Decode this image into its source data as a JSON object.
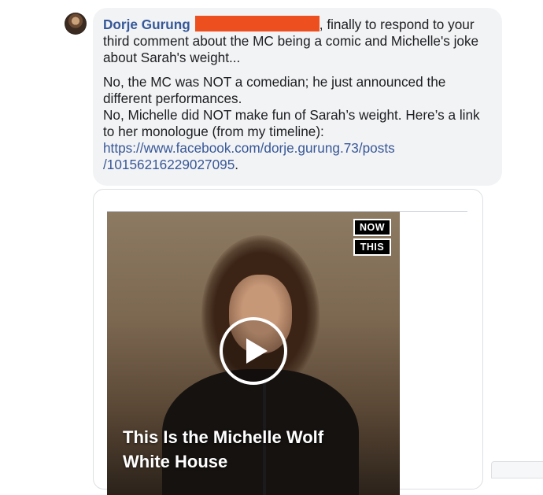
{
  "comment": {
    "author": "Dorje Gurung",
    "intro_text": ", finally to respond to your third comment about the MC being a comic and Michelle's joke about Sarah's weight...",
    "line1": "No, the MC was NOT a comedian; he just announced the different performances.",
    "line2": "No, Michelle did NOT make fun of Sarah’s weight. Here’s a link to her monologue (from my timeline):",
    "link": "https://www.facebook.com/dorje.gurung.73/posts/10156216229027095",
    "trailing": ".",
    "redaction_color": "#ee4f1e"
  },
  "attachment": {
    "badge_top": "NOW",
    "badge_bottom": "THIS",
    "video_title": "This Is the Michelle Wolf White House",
    "play_icon": "play-icon"
  },
  "colors": {
    "author": "#365899",
    "link": "#385898",
    "bubble_bg": "#f2f3f5"
  }
}
